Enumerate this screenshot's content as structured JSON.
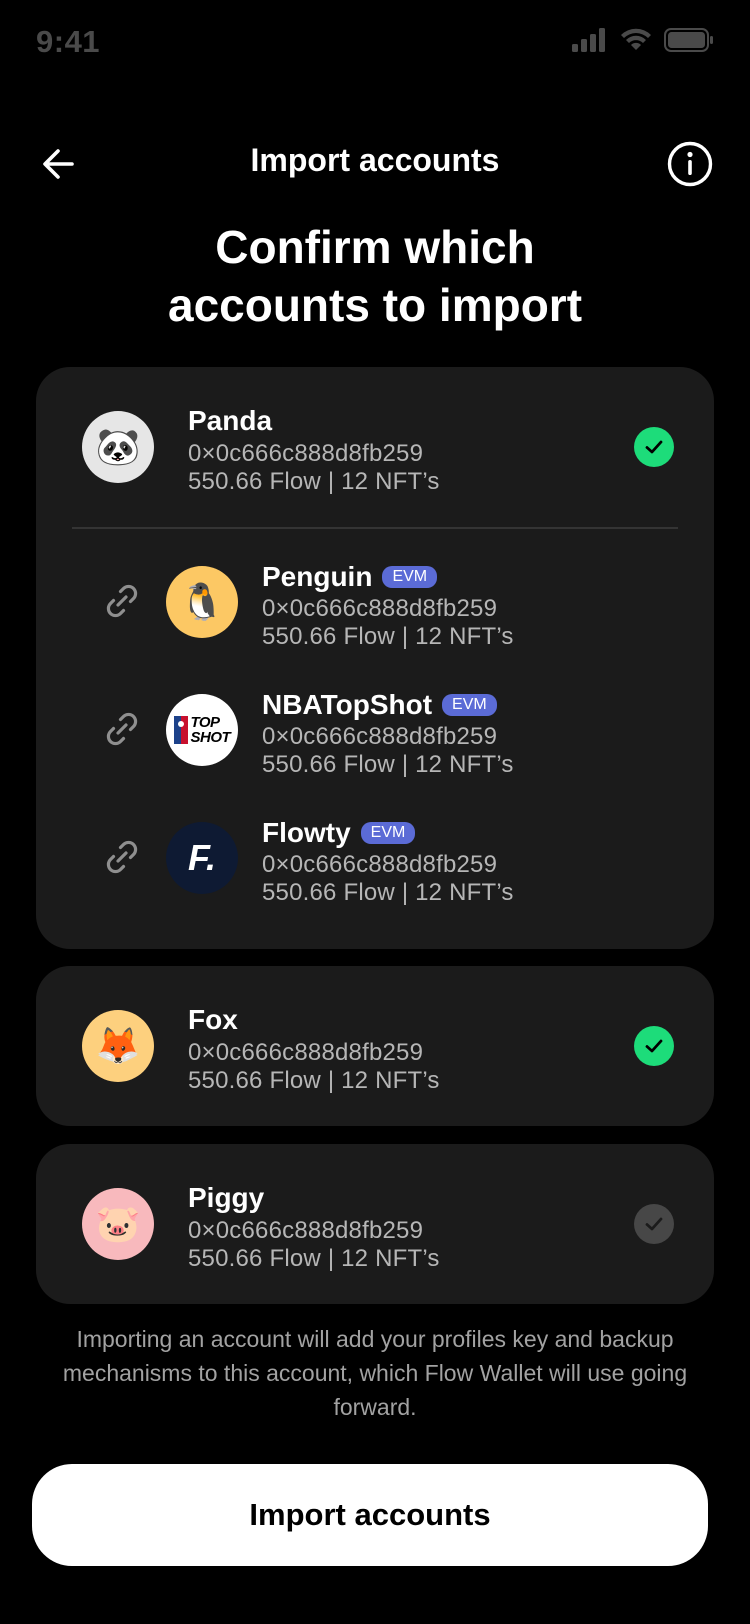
{
  "status_bar": {
    "time": "9:41"
  },
  "header": {
    "title": "Import accounts"
  },
  "headline": {
    "line1": "Confirm which",
    "line2": "accounts to import"
  },
  "accounts": [
    {
      "name": "Panda",
      "address": "0×0c666c888d8fb259",
      "summary": "550.66 Flow | 12 NFT’s",
      "avatar_emoji": "🐼",
      "avatar_color": "#e6e6e6",
      "selected": true,
      "linked": [
        {
          "name": "Penguin",
          "badge": "EVM",
          "address": "0×0c666c888d8fb259",
          "summary": "550.66 Flow | 12 NFT’s",
          "avatar_emoji": "🐧",
          "avatar_color": "#fcc864"
        },
        {
          "name": "NBATopShot",
          "badge": "EVM",
          "address": "0×0c666c888d8fb259",
          "summary": "550.66 Flow | 12 NFT’s",
          "avatar_text": "TOP SHOT",
          "avatar_color": "#ffffff"
        },
        {
          "name": "Flowty",
          "badge": "EVM",
          "address": "0×0c666c888d8fb259",
          "summary": "550.66 Flow | 12 NFT’s",
          "avatar_text": "F.",
          "avatar_color": "#0e1a33"
        }
      ]
    },
    {
      "name": "Fox",
      "address": "0×0c666c888d8fb259",
      "summary": "550.66 Flow | 12 NFT’s",
      "avatar_emoji": "🦊",
      "avatar_color": "#fdd07e",
      "selected": true
    },
    {
      "name": "Piggy",
      "address": "0×0c666c888d8fb259",
      "summary": "550.66 Flow | 12 NFT’s",
      "avatar_emoji": "🐷",
      "avatar_color": "#f8b9bd",
      "selected": false
    }
  ],
  "disclaimer": "Importing an account will add your profiles key and backup mechanisms to this account, which Flow Wallet will use going forward.",
  "import_button": {
    "label": "Import accounts"
  },
  "colors": {
    "background": "#000000",
    "card": "#1b1b1b",
    "selected": "#1ddc7a",
    "unselected": "#474747",
    "evm_badge": "#5b6bd6"
  }
}
